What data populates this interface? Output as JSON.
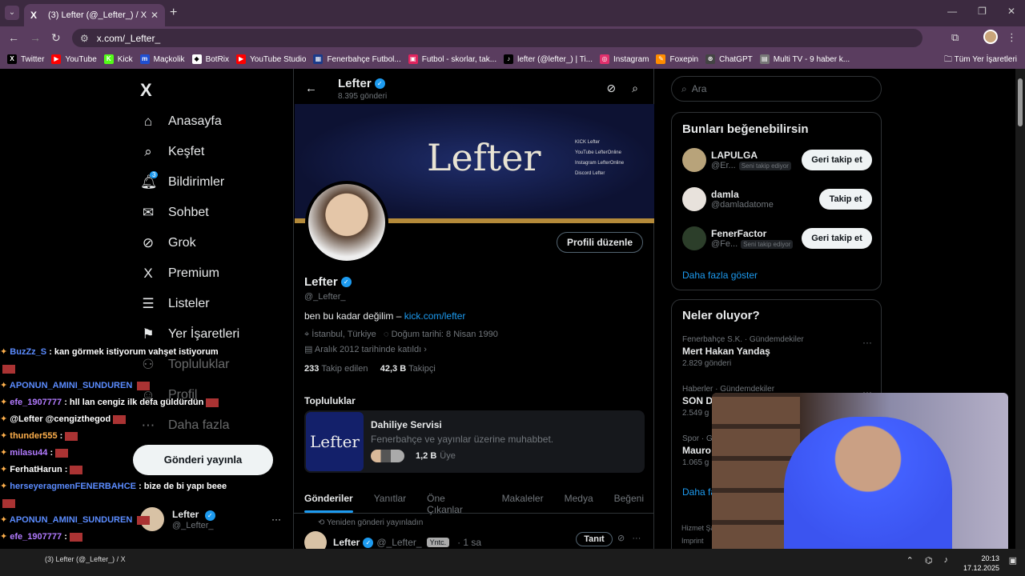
{
  "browser": {
    "tab_title": "(3) Lefter (@_Lefter_) / X",
    "url": "x.com/_Lefter_",
    "bookmarks": [
      {
        "label": "Twitter",
        "color": "#000000",
        "glyph": "X"
      },
      {
        "label": "YouTube",
        "color": "#ff0000",
        "glyph": "▶"
      },
      {
        "label": "Kick",
        "color": "#53fc18",
        "glyph": "K"
      },
      {
        "label": "Maçkolik",
        "color": "#1f4fd1",
        "glyph": "m"
      },
      {
        "label": "BotRix",
        "color": "#ffffff",
        "glyph": "◆"
      },
      {
        "label": "YouTube Studio",
        "color": "#ff0000",
        "glyph": "▶"
      },
      {
        "label": "Fenerbahçe Futbol...",
        "color": "#1b3b8a",
        "glyph": "▦"
      },
      {
        "label": "Futbol - skorlar, tak...",
        "color": "#e0245e",
        "glyph": "▣"
      },
      {
        "label": "lefter (@lefter_) | Ti...",
        "color": "#000000",
        "glyph": "♪"
      },
      {
        "label": "Instagram",
        "color": "#e1306c",
        "glyph": "◎"
      },
      {
        "label": "Foxepin",
        "color": "#ff8c00",
        "glyph": "✎"
      },
      {
        "label": "ChatGPT",
        "color": "#444444",
        "glyph": "⊛"
      },
      {
        "label": "Multi TV - 9 haber k...",
        "color": "#777777",
        "glyph": "▤"
      }
    ],
    "bookmarks_all": "Tüm Yer İşaretleri"
  },
  "nav": {
    "items": [
      {
        "label": "Anasayfa",
        "icon": "⌂"
      },
      {
        "label": "Keşfet",
        "icon": "⌕"
      },
      {
        "label": "Bildirimler",
        "icon": "🔔︎"
      },
      {
        "label": "Sohbet",
        "icon": "✉"
      },
      {
        "label": "Grok",
        "icon": "⊘"
      },
      {
        "label": "Premium",
        "icon": "X"
      },
      {
        "label": "Listeler",
        "icon": "☰"
      },
      {
        "label": "Yer İşaretleri",
        "icon": "⚑"
      },
      {
        "label": "Topluluklar",
        "icon": "⚇"
      },
      {
        "label": "Profil",
        "icon": "☺"
      },
      {
        "label": "Daha fazla",
        "icon": "⋯"
      }
    ],
    "notif_count": "3",
    "post_button": "Gönderi yayınla",
    "me_name": "Lefter",
    "me_handle": "@_Lefter_"
  },
  "chat": [
    {
      "user": "BuzZz_S",
      "cls": "u",
      "msg": ": kan görmek istiyorum vahşet istiyorum"
    },
    {
      "user": "APONUN_AMINI_SUNDUREN",
      "cls": "u",
      "msg": ""
    },
    {
      "user": "efe_1907777",
      "cls": "p",
      "msg": ": hll lan cengiz ilk defa güldürdün"
    },
    {
      "user": "",
      "cls": "u",
      "msg": "@Lefter @cengizthegod"
    },
    {
      "user": "thunder555",
      "cls": "o",
      "msg": ":"
    },
    {
      "user": "milasu44",
      "cls": "p",
      "msg": ":"
    },
    {
      "user": "FerhatHarun",
      "cls": "",
      "msg": ":"
    },
    {
      "user": "herseyeragmenFENERBAHCE",
      "cls": "u",
      "msg": ": bize de bi yapı beee"
    },
    {
      "user": "APONUN_AMINI_SUNDUREN",
      "cls": "u",
      "msg": ""
    },
    {
      "user": "efe_1907777",
      "cls": "p",
      "msg": ":"
    }
  ],
  "profile": {
    "header_name": "Lefter",
    "post_count": "8.395 gönderi",
    "banner_logo": "Lefter",
    "banner_links": [
      "KICK Lefter",
      "YouTube LefterOnline",
      "Instagram LefterOnline",
      "Discord Lefter"
    ],
    "edit_button": "Profili düzenle",
    "name": "Lefter",
    "handle": "@_Lefter_",
    "bio_text": "ben bu kadar değilim – ",
    "bio_link": "kick.com/lefter",
    "location": "İstanbul, Türkiye",
    "birth": "Doğum tarihi: 8 Nisan 1990",
    "joined": "Aralık 2012 tarihinde katıldı",
    "following_count": "233",
    "following_label": "Takip edilen",
    "followers_count": "42,3 B",
    "followers_label": "Takipçi",
    "communities_title": "Topluluklar",
    "community": {
      "image_text": "Lefter",
      "name": "Dahiliye Servisi",
      "desc": "Fenerbahçe ve yayınlar üzerine muhabbet.",
      "members": "1,2 B",
      "members_label": "Üye"
    },
    "tabs": [
      "Gönderiler",
      "Yanıtlar",
      "Öne Çıkanlar",
      "Makaleler",
      "Medya",
      "Beğeni"
    ],
    "repost_note": "Yeniden gönderi yayınladın",
    "post": {
      "name": "Lefter",
      "handle": "@_Lefter_",
      "chip": "Yntc.",
      "time": "· 1 sa",
      "promote": "Tanıt"
    }
  },
  "sidebar": {
    "search_placeholder": "Ara",
    "who_title": "Bunları beğenebilirsin",
    "suggestions": [
      {
        "name": "LAPULGA",
        "handle": "@Er...",
        "follows_you": "Seni takip ediyor",
        "button": "Geri takip et",
        "avatar_color": "#b8a37a"
      },
      {
        "name": "damla",
        "handle": "@damladatome",
        "follows_you": "",
        "button": "Takip et",
        "avatar_color": "#e8e2dc"
      },
      {
        "name": "FenerFactor",
        "handle": "@Fe...",
        "follows_you": "Seni takip ediyor",
        "button": "Geri takip et",
        "avatar_color": "#2c3e2a"
      }
    ],
    "show_more": "Daha fazla göster",
    "trends_title": "Neler oluyor?",
    "trends": [
      {
        "context": "Fenerbahçe S.K. · Gündemdekiler",
        "title": "Mert Hakan Yandaş",
        "count": "2.829 gönderi"
      },
      {
        "context": "Haberler · Gündemdekiler",
        "title": "SON DA",
        "count": "2.549 g"
      },
      {
        "context": "Spor · Gü",
        "title": "Mauro I",
        "count": "1.065 g"
      }
    ],
    "trends_more": "Daha fa",
    "footer": [
      "Hizmet Şa",
      "Imprint"
    ]
  },
  "taskbar": {
    "task_label": "(3) Lefter (@_Lefter_) / X",
    "time": "20:13",
    "date": "17.12.2025"
  }
}
